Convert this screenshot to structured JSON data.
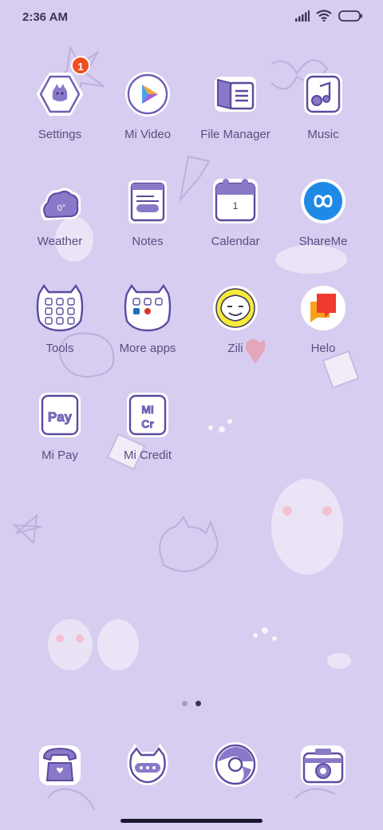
{
  "status_bar": {
    "time": "2:36 AM"
  },
  "apps": [
    {
      "label": "Settings",
      "badge": "1"
    },
    {
      "label": "Mi Video"
    },
    {
      "label": "File Manager"
    },
    {
      "label": "Music"
    },
    {
      "label": "Weather",
      "icon_text": "0°"
    },
    {
      "label": "Notes"
    },
    {
      "label": "Calendar",
      "icon_text": "1"
    },
    {
      "label": "ShareMe"
    },
    {
      "label": "Tools"
    },
    {
      "label": "More apps"
    },
    {
      "label": "Zili"
    },
    {
      "label": "Helo"
    },
    {
      "label": "Mi Pay",
      "icon_text": "Pay"
    },
    {
      "label": "Mi Credit",
      "icon_text_1": "MI",
      "icon_text_2": "Cr"
    }
  ],
  "pager": {
    "pages": 2,
    "active_page": 2
  },
  "colors": {
    "background": "#d7cdf0",
    "icon_purple": "#8a78c8",
    "badge": "#f04f23",
    "text": "#5b4d82"
  }
}
